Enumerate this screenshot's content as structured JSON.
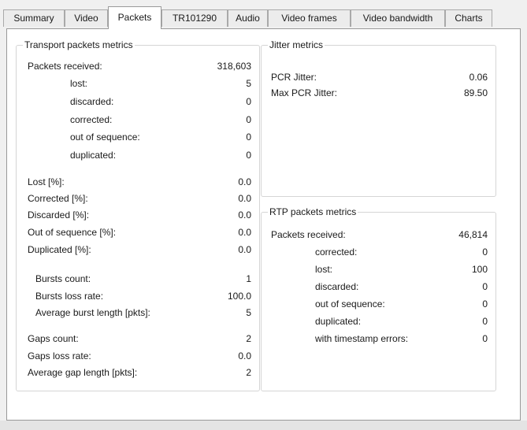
{
  "tabs": [
    "Summary",
    "Video",
    "Packets",
    "TR101290",
    "Audio",
    "Video frames",
    "Video bandwidth",
    "Charts"
  ],
  "active_tab": "Packets",
  "transport": {
    "title": "Transport packets metrics",
    "rows": [
      {
        "label": "Packets received:",
        "value": "318,603"
      },
      {
        "label": "lost:",
        "value": "5"
      },
      {
        "label": "discarded:",
        "value": "0"
      },
      {
        "label": "corrected:",
        "value": "0"
      },
      {
        "label": "out of sequence:",
        "value": "0"
      },
      {
        "label": "duplicated:",
        "value": "0"
      },
      {
        "label": "Lost [%]:",
        "value": "0.0"
      },
      {
        "label": "Corrected [%]:",
        "value": "0.0"
      },
      {
        "label": "Discarded [%]:",
        "value": "0.0"
      },
      {
        "label": "Out of sequence [%]:",
        "value": "0.0"
      },
      {
        "label": "Duplicated [%]:",
        "value": "0.0"
      },
      {
        "label": "Bursts count:",
        "value": "1"
      },
      {
        "label": "Bursts loss rate:",
        "value": "100.0"
      },
      {
        "label": "Average burst length [pkts]:",
        "value": "5"
      },
      {
        "label": "Gaps count:",
        "value": "2"
      },
      {
        "label": "Gaps loss rate:",
        "value": "0.0"
      },
      {
        "label": "Average gap length [pkts]:",
        "value": "2"
      }
    ]
  },
  "jitter": {
    "title": "Jitter metrics",
    "rows": [
      {
        "label": "PCR Jitter:",
        "value": "0.06"
      },
      {
        "label": "Max PCR Jitter:",
        "value": "89.50"
      }
    ]
  },
  "rtp": {
    "title": "RTP packets metrics",
    "rows": [
      {
        "label": "Packets received:",
        "value": "46,814"
      },
      {
        "label": "corrected:",
        "value": "0"
      },
      {
        "label": "lost:",
        "value": "100"
      },
      {
        "label": "discarded:",
        "value": "0"
      },
      {
        "label": "out of sequence:",
        "value": "0"
      },
      {
        "label": "duplicated:",
        "value": "0"
      },
      {
        "label": "with timestamp errors:",
        "value": "0"
      }
    ]
  }
}
